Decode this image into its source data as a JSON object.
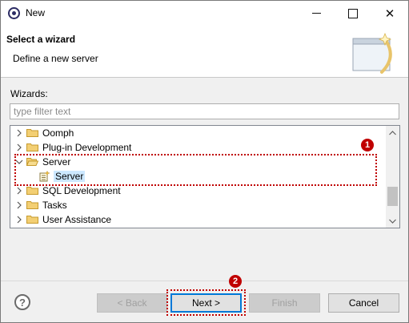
{
  "window": {
    "title": "New"
  },
  "header": {
    "title": "Select a wizard",
    "subtitle": "Define a new server"
  },
  "wizards": {
    "label": "Wizards:",
    "filter_placeholder": "type filter text",
    "items": [
      {
        "label": "Oomph",
        "expanded": false,
        "icon": "folder-icon"
      },
      {
        "label": "Plug-in Development",
        "expanded": false,
        "icon": "folder-icon"
      },
      {
        "label": "Server",
        "expanded": true,
        "icon": "folder-icon"
      },
      {
        "label": "Server",
        "child": true,
        "selected": true,
        "icon": "server-wizard-icon"
      },
      {
        "label": "SQL Development",
        "expanded": false,
        "icon": "folder-icon"
      },
      {
        "label": "Tasks",
        "expanded": false,
        "icon": "folder-icon"
      },
      {
        "label": "User Assistance",
        "expanded": false,
        "icon": "folder-icon"
      }
    ]
  },
  "annotations": {
    "badge1": "1",
    "badge2": "2",
    "color": "#c00000"
  },
  "buttons": {
    "help": "?",
    "back": "< Back",
    "next": "Next >",
    "finish": "Finish",
    "cancel": "Cancel"
  },
  "colors": {
    "selection": "#cce8ff",
    "folder": "#e8b64c",
    "accent": "#0078d7"
  }
}
